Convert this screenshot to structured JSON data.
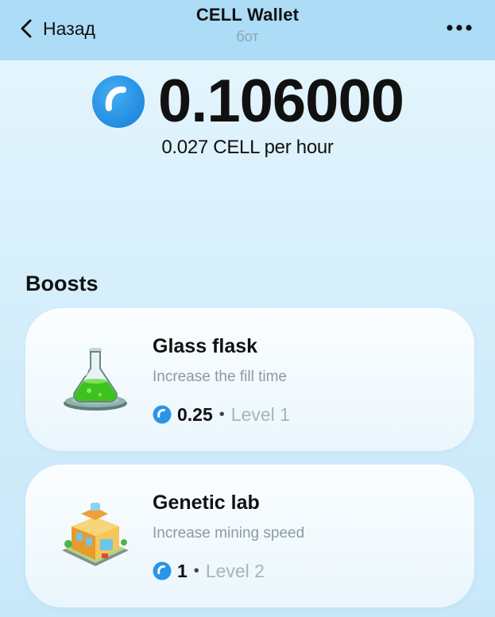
{
  "header": {
    "back_label": "Назад",
    "title": "CELL Wallet",
    "subtitle": "бот"
  },
  "balance": {
    "amount": "0.106000",
    "rate": "0.027 CELL per hour"
  },
  "boosts": {
    "title": "Boosts",
    "items": [
      {
        "title": "Glass flask",
        "description": "Increase the fill time",
        "price": "0.25",
        "separator": "•",
        "level": "Level 1",
        "icon": "glass-flask-icon"
      },
      {
        "title": "Genetic lab",
        "description": "Increase mining speed",
        "price": "1",
        "separator": "•",
        "level": "Level 2",
        "icon": "genetic-lab-icon"
      }
    ]
  },
  "colors": {
    "header_bg": "#acdcf6",
    "accent_blue": "#2a95e8",
    "muted_text": "#8a9aa6",
    "level_text": "#a7b4bd"
  }
}
